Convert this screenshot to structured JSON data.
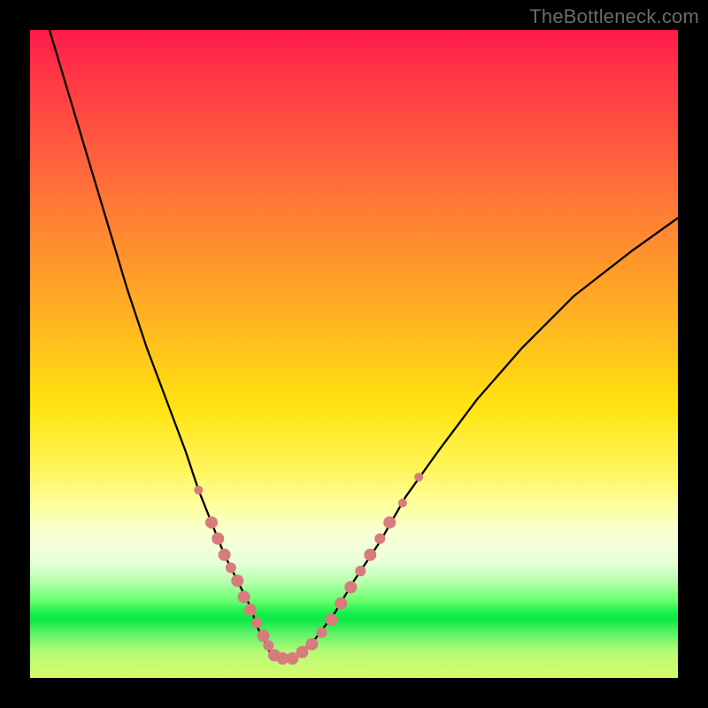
{
  "watermark": "TheBottleneck.com",
  "colors": {
    "curve": "#000000",
    "markers_fill": "#d77b7c",
    "markers_stroke": "#c96a6b",
    "bg_black": "#000000"
  },
  "chart_data": {
    "type": "line",
    "title": "",
    "xlabel": "",
    "ylabel": "",
    "xlim": [
      0,
      100
    ],
    "ylim": [
      0,
      100
    ],
    "series": [
      {
        "name": "bottleneck-curve",
        "x": [
          3,
          6,
          9,
          12,
          15,
          18,
          21,
          24,
          26,
          28,
          30,
          32,
          34,
          35,
          36,
          37,
          38,
          40,
          42,
          44,
          47,
          50,
          54,
          58,
          63,
          69,
          76,
          84,
          93,
          100
        ],
        "y": [
          100,
          90,
          80,
          70,
          60,
          51,
          43,
          35,
          29,
          24,
          19,
          15,
          11,
          8,
          6,
          4,
          3,
          3,
          4,
          6,
          10,
          15,
          21,
          28,
          35,
          43,
          51,
          59,
          66,
          71
        ]
      }
    ],
    "markers": {
      "name": "highlight-points",
      "points": [
        {
          "x": 26,
          "y": 29,
          "r": 5
        },
        {
          "x": 28,
          "y": 24,
          "r": 7
        },
        {
          "x": 29,
          "y": 21.5,
          "r": 7
        },
        {
          "x": 30,
          "y": 19,
          "r": 7
        },
        {
          "x": 31,
          "y": 17,
          "r": 6
        },
        {
          "x": 32,
          "y": 15,
          "r": 7
        },
        {
          "x": 33,
          "y": 12.5,
          "r": 7
        },
        {
          "x": 34,
          "y": 10.5,
          "r": 7
        },
        {
          "x": 35,
          "y": 8.5,
          "r": 6
        },
        {
          "x": 36,
          "y": 6.5,
          "r": 7
        },
        {
          "x": 36.8,
          "y": 5,
          "r": 6
        },
        {
          "x": 37.7,
          "y": 3.5,
          "r": 7
        },
        {
          "x": 39,
          "y": 3,
          "r": 7
        },
        {
          "x": 40.5,
          "y": 3,
          "r": 7
        },
        {
          "x": 42,
          "y": 4,
          "r": 7
        },
        {
          "x": 43.5,
          "y": 5.2,
          "r": 7
        },
        {
          "x": 45,
          "y": 7,
          "r": 6
        },
        {
          "x": 46.5,
          "y": 9,
          "r": 7
        },
        {
          "x": 48,
          "y": 11.5,
          "r": 7
        },
        {
          "x": 49.5,
          "y": 14,
          "r": 7
        },
        {
          "x": 51,
          "y": 16.5,
          "r": 6
        },
        {
          "x": 52.5,
          "y": 19,
          "r": 7
        },
        {
          "x": 54,
          "y": 21.5,
          "r": 6
        },
        {
          "x": 55.5,
          "y": 24,
          "r": 7
        },
        {
          "x": 57.5,
          "y": 27,
          "r": 5
        },
        {
          "x": 60,
          "y": 31,
          "r": 5
        }
      ]
    }
  }
}
